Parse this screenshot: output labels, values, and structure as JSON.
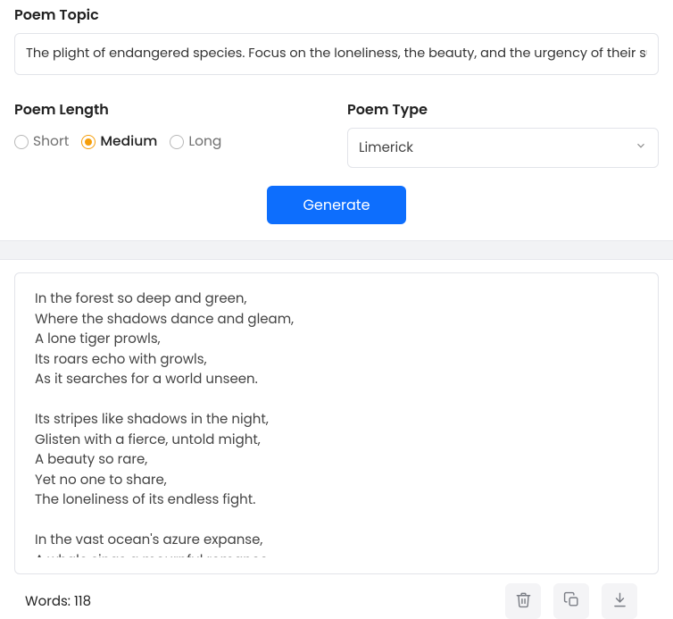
{
  "topic": {
    "label": "Poem Topic",
    "value": "The plight of endangered species. Focus on the loneliness, the beauty, and the urgency of their survival"
  },
  "length": {
    "label": "Poem Length",
    "options": [
      "Short",
      "Medium",
      "Long"
    ],
    "selected": "Medium"
  },
  "type": {
    "label": "Poem Type",
    "selected": "Limerick"
  },
  "generate_label": "Generate",
  "output": {
    "text": "In the forest so deep and green,\nWhere the shadows dance and gleam,\nA lone tiger prowls,\nIts roars echo with growls,\nAs it searches for a world unseen.\n\nIts stripes like shadows in the night,\nGlisten with a fierce, untold might,\nA beauty so rare,\nYet no one to share,\nThe loneliness of its endless fight.\n\nIn the vast ocean's azure expanse,\nA whale sings a mournful romance,"
  },
  "footer": {
    "words_label": "Words: 118"
  }
}
